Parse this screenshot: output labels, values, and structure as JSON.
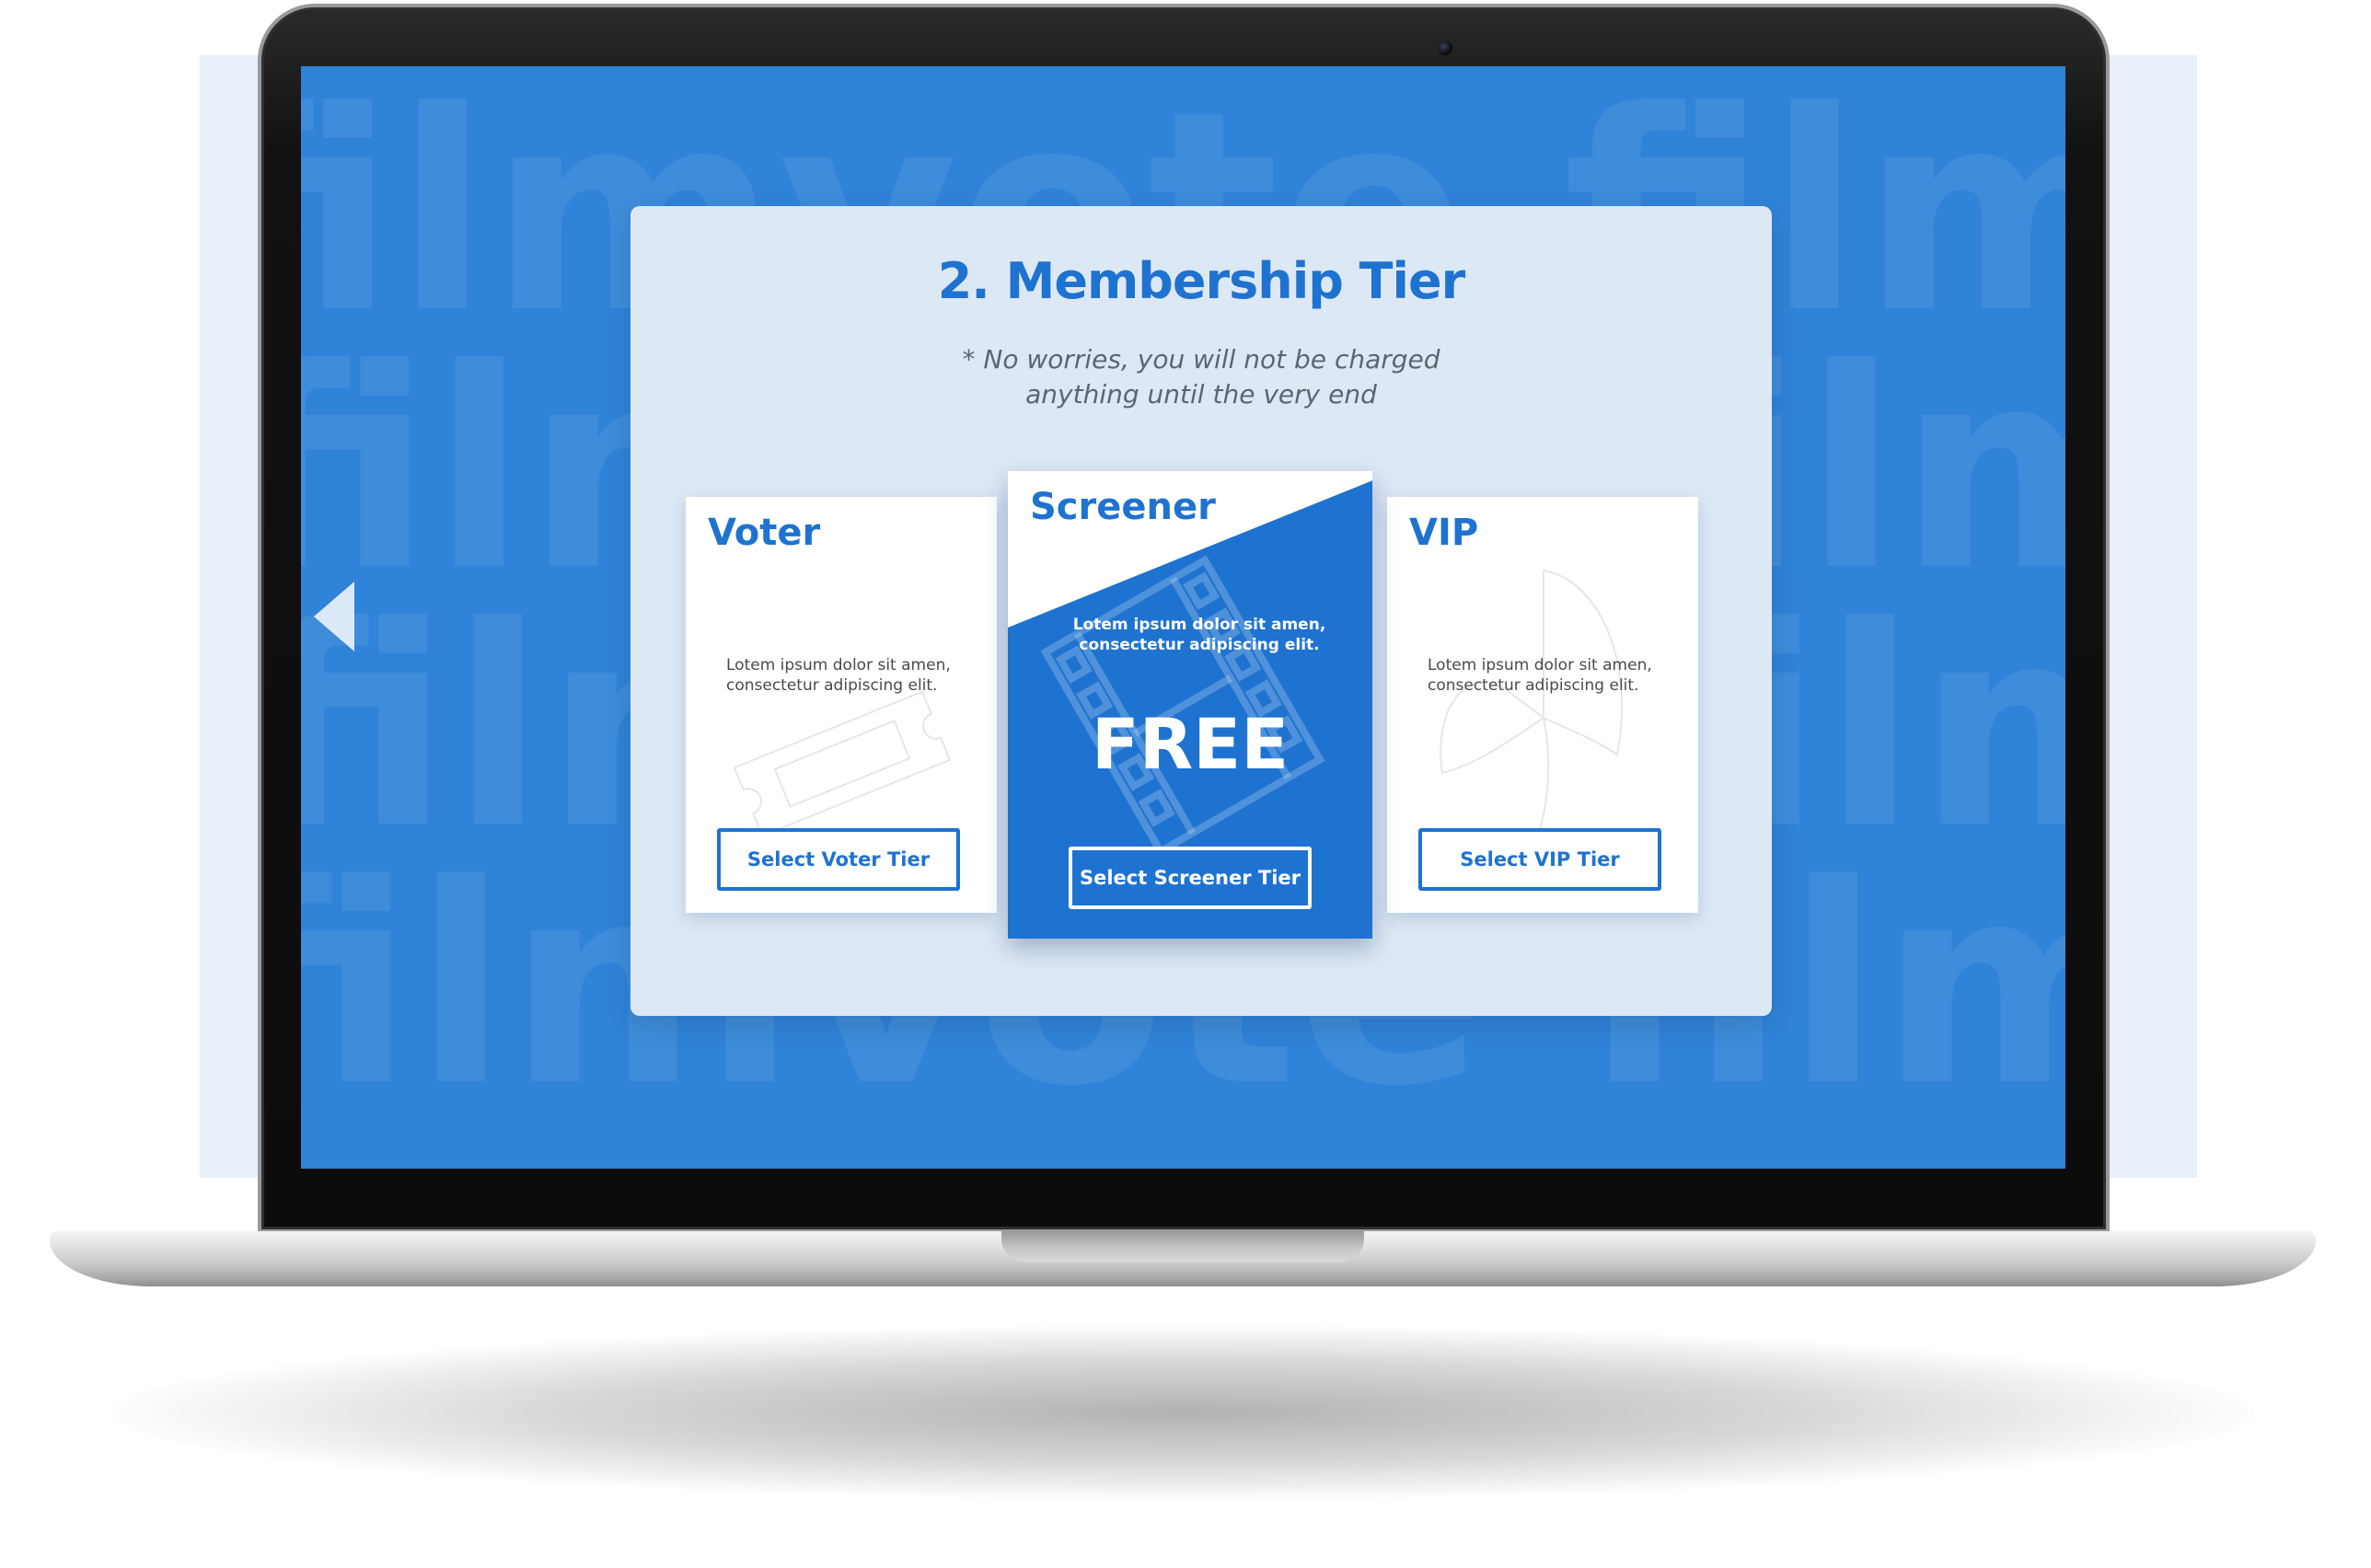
{
  "screen": {
    "watermark_rows": [
      "filmvote filmvote",
      "filmvote filmvote",
      "filmvote filmvote",
      "filmvote filmvote"
    ]
  },
  "panel": {
    "title": "2. Membership Tier",
    "subtitle_line1": "* No worries,  you will not be charged",
    "subtitle_line2": "anything until the very end"
  },
  "tiers": [
    {
      "title": "Voter",
      "desc_line1": "Lotem ipsum dolor sit amen,",
      "desc_line2": "consectetur adipiscing elit.",
      "button_label": "Select Voter Tier",
      "icon": "ticket-icon"
    },
    {
      "title": "Screener",
      "desc_line1": "Lotem ipsum dolor sit amen,",
      "desc_line2": "consectetur adipiscing elit.",
      "price": "FREE",
      "button_label": "Select Screener Tier",
      "icon": "film-strip-icon"
    },
    {
      "title": "VIP",
      "desc_line1": "Lotem ipsum dolor sit amen,",
      "desc_line2": "consectetur adipiscing elit.",
      "button_label": "Select VIP Tier",
      "icon": "bowtie-icon"
    }
  ],
  "colors": {
    "screen_bg": "#2f83d8",
    "panel_bg": "#dde8f5",
    "accent": "#1f73d0",
    "featured_card_bg": "#1e73d0"
  }
}
